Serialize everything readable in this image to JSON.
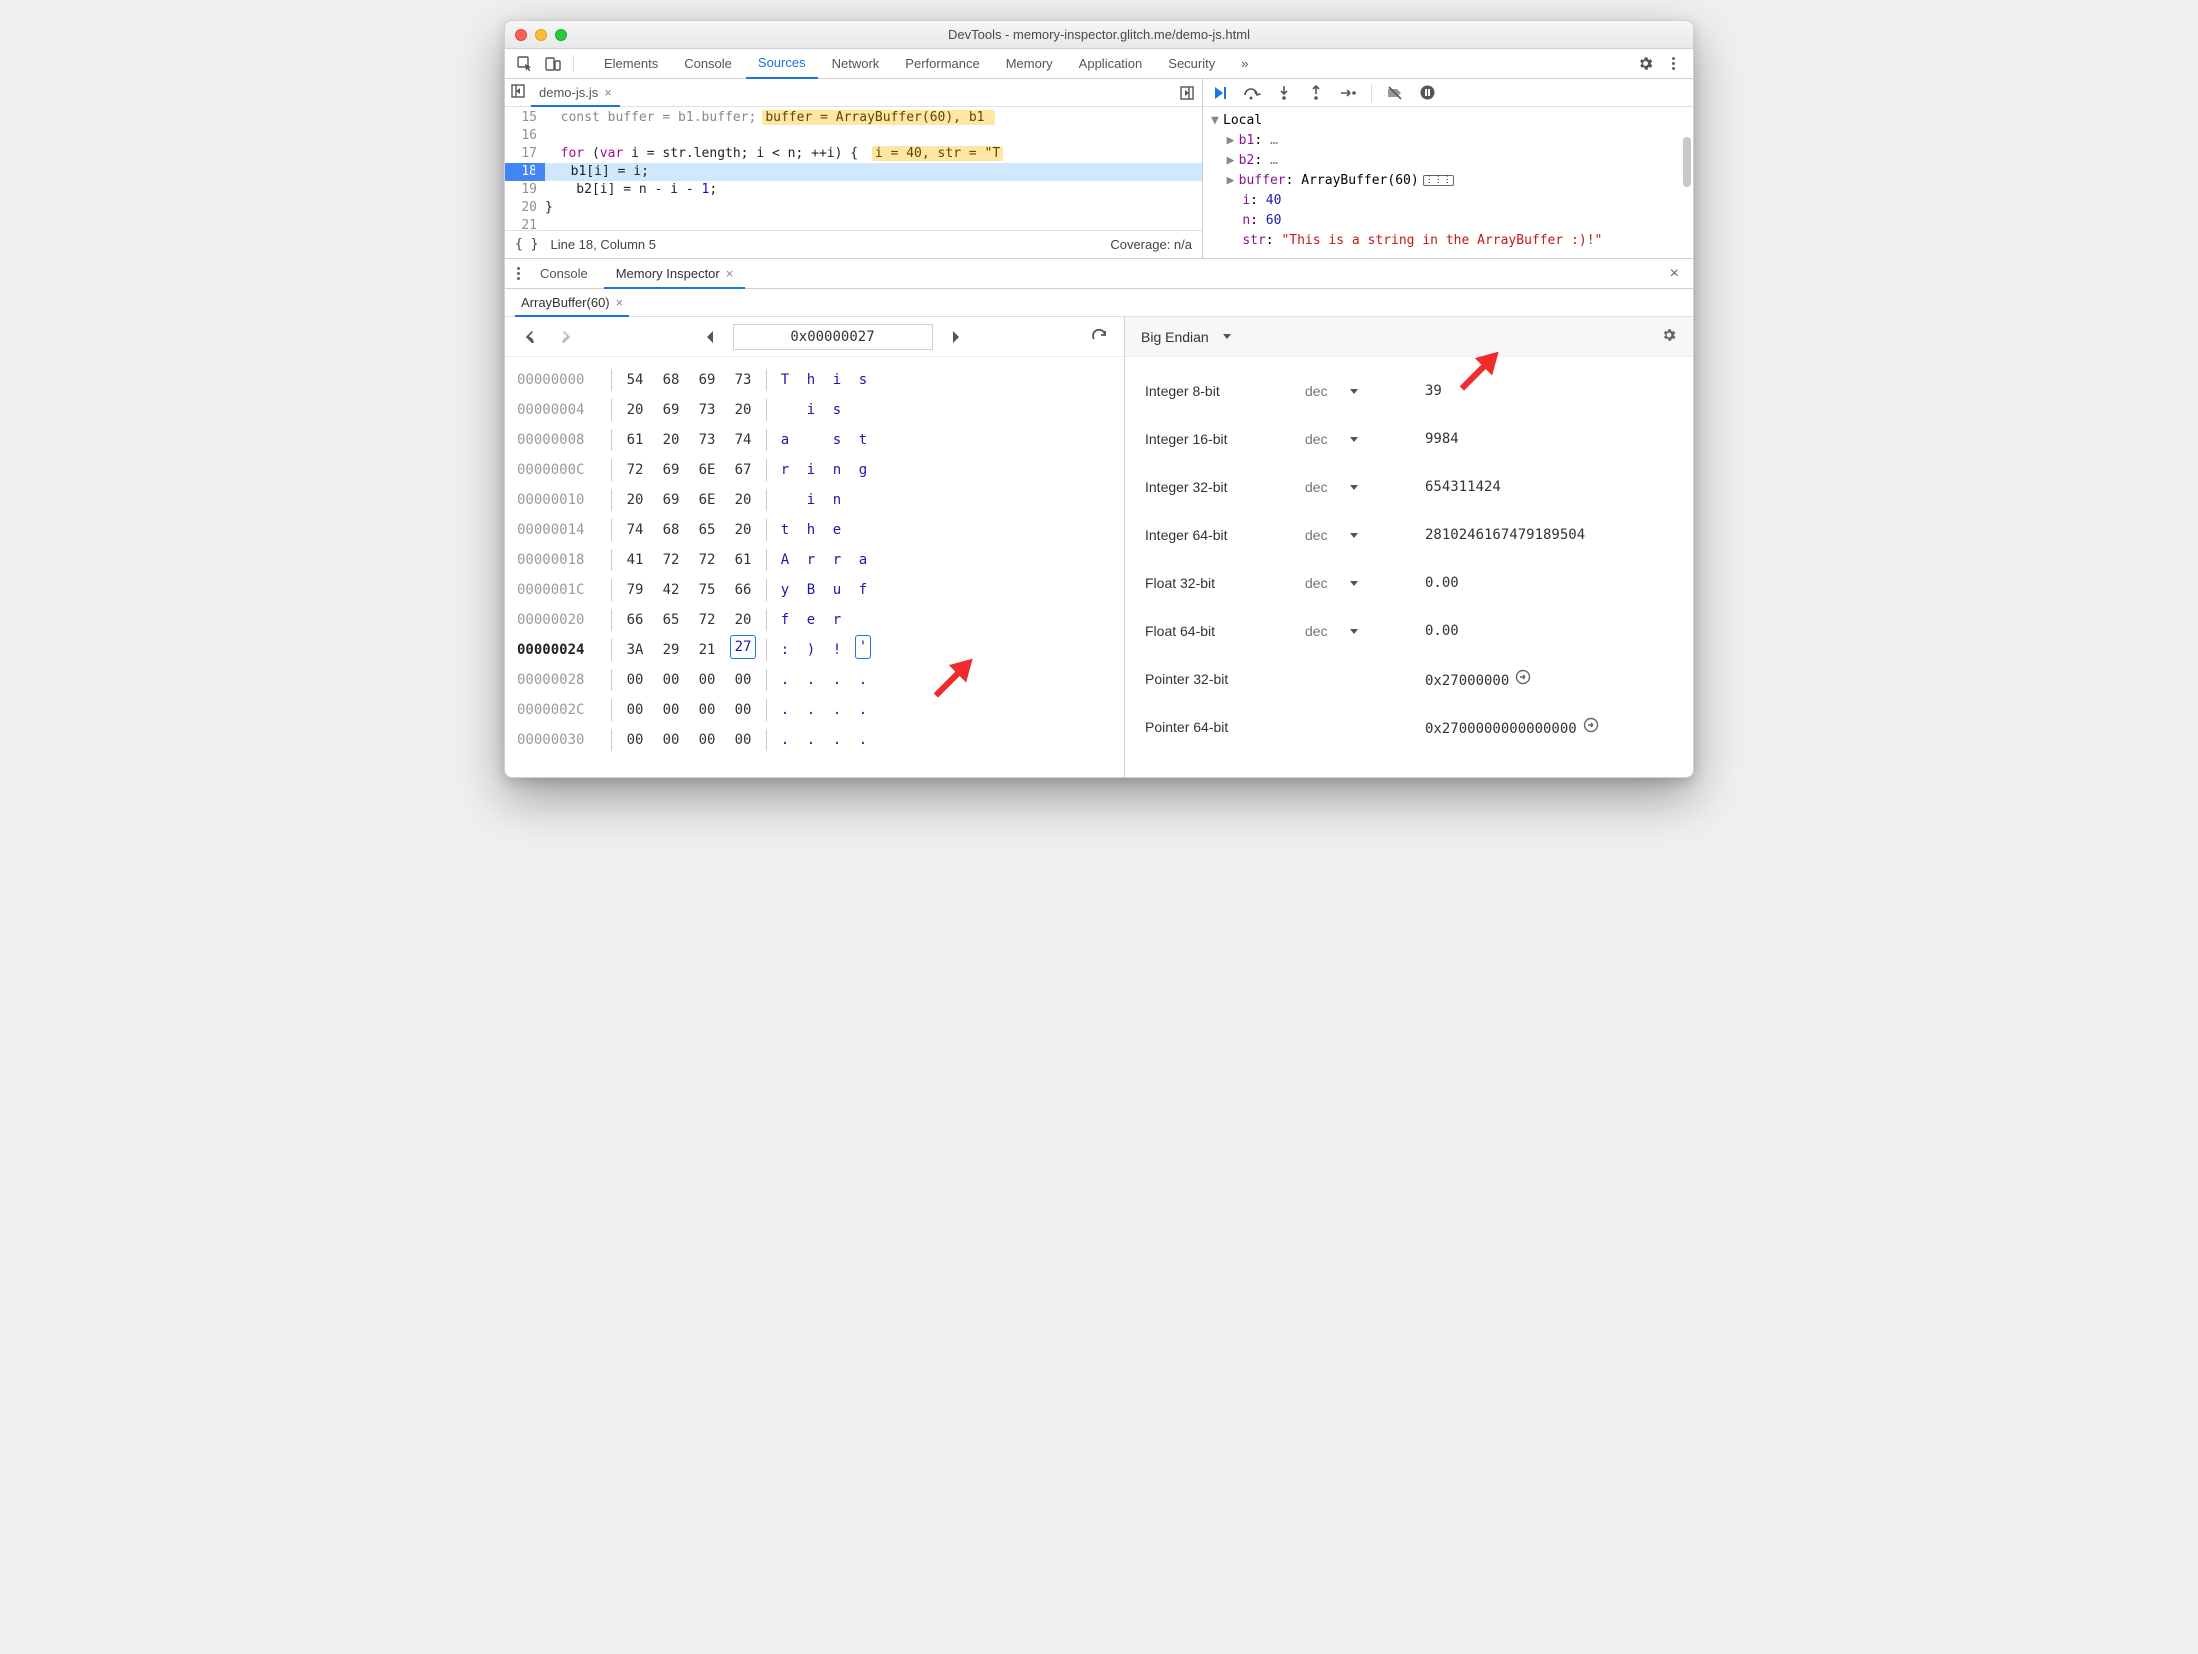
{
  "window": {
    "title": "DevTools - memory-inspector.glitch.me/demo-js.html"
  },
  "main_tabs": {
    "elements": "Elements",
    "console": "Console",
    "sources": "Sources",
    "network": "Network",
    "performance": "Performance",
    "memory": "Memory",
    "application": "Application",
    "security": "Security"
  },
  "source": {
    "file_tab": "demo-js.js",
    "lines": {
      "15": {
        "num": "15",
        "text": "const buffer = b1.buffer;",
        "inline": "buffer = ArrayBuffer(60), b1 "
      },
      "16": {
        "num": "16",
        "text": ""
      },
      "17": {
        "num": "17",
        "text": "for (var i = str.length; i < n; ++i) {",
        "inline": "i = 40, str = \"T"
      },
      "18": {
        "num": "18",
        "text": "  b1[i] = i;"
      },
      "19": {
        "num": "19",
        "text": "  b2[i] = n - i - 1;"
      },
      "20": {
        "num": "20",
        "text": "}"
      },
      "21": {
        "num": "21",
        "text": ""
      }
    },
    "status_line": "Line 18, Column 5",
    "status_coverage": "Coverage: n/a"
  },
  "scope": {
    "header": "Local",
    "b1": {
      "name": "b1",
      "val": "…"
    },
    "b2": {
      "name": "b2",
      "val": "…"
    },
    "buffer": {
      "name": "buffer",
      "val": "ArrayBuffer(60)"
    },
    "i": {
      "name": "i",
      "val": "40"
    },
    "n": {
      "name": "n",
      "val": "60"
    },
    "str": {
      "name": "str",
      "val": "\"This is a string in the ArrayBuffer :)!\""
    }
  },
  "drawer": {
    "console": "Console",
    "mem": "Memory Inspector"
  },
  "mi": {
    "tab": "ArrayBuffer(60)",
    "address": "0x00000027",
    "rows": [
      {
        "addr": "00000000",
        "b": [
          "54",
          "68",
          "69",
          "73"
        ],
        "a": [
          "T",
          "h",
          "i",
          "s"
        ]
      },
      {
        "addr": "00000004",
        "b": [
          "20",
          "69",
          "73",
          "20"
        ],
        "a": [
          "",
          "i",
          "s",
          ""
        ]
      },
      {
        "addr": "00000008",
        "b": [
          "61",
          "20",
          "73",
          "74"
        ],
        "a": [
          "a",
          "",
          "s",
          "t"
        ]
      },
      {
        "addr": "0000000C",
        "b": [
          "72",
          "69",
          "6E",
          "67"
        ],
        "a": [
          "r",
          "i",
          "n",
          "g"
        ]
      },
      {
        "addr": "00000010",
        "b": [
          "20",
          "69",
          "6E",
          "20"
        ],
        "a": [
          "",
          "i",
          "n",
          ""
        ]
      },
      {
        "addr": "00000014",
        "b": [
          "74",
          "68",
          "65",
          "20"
        ],
        "a": [
          "t",
          "h",
          "e",
          ""
        ]
      },
      {
        "addr": "00000018",
        "b": [
          "41",
          "72",
          "72",
          "61"
        ],
        "a": [
          "A",
          "r",
          "r",
          "a"
        ]
      },
      {
        "addr": "0000001C",
        "b": [
          "79",
          "42",
          "75",
          "66"
        ],
        "a": [
          "y",
          "B",
          "u",
          "f"
        ]
      },
      {
        "addr": "00000020",
        "b": [
          "66",
          "65",
          "72",
          "20"
        ],
        "a": [
          "f",
          "e",
          "r",
          ""
        ]
      },
      {
        "addr": "00000024",
        "b": [
          "3A",
          "29",
          "21",
          "27"
        ],
        "a": [
          ":",
          ")",
          "!",
          "'"
        ],
        "bold": true,
        "sel": 3
      },
      {
        "addr": "00000028",
        "b": [
          "00",
          "00",
          "00",
          "00"
        ],
        "a": [
          ".",
          ".",
          ".",
          "."
        ]
      },
      {
        "addr": "0000002C",
        "b": [
          "00",
          "00",
          "00",
          "00"
        ],
        "a": [
          ".",
          ".",
          ".",
          "."
        ]
      },
      {
        "addr": "00000030",
        "b": [
          "00",
          "00",
          "00",
          "00"
        ],
        "a": [
          ".",
          ".",
          ".",
          "."
        ]
      }
    ],
    "endian": "Big Endian",
    "values": [
      {
        "label": "Integer 8-bit",
        "fmt": "dec",
        "val": "39"
      },
      {
        "label": "Integer 16-bit",
        "fmt": "dec",
        "val": "9984"
      },
      {
        "label": "Integer 32-bit",
        "fmt": "dec",
        "val": "654311424"
      },
      {
        "label": "Integer 64-bit",
        "fmt": "dec",
        "val": "2810246167479189504"
      },
      {
        "label": "Float 32-bit",
        "fmt": "dec",
        "val": "0.00"
      },
      {
        "label": "Float 64-bit",
        "fmt": "dec",
        "val": "0.00"
      },
      {
        "label": "Pointer 32-bit",
        "fmt": "",
        "val": "0x27000000",
        "goto": true
      },
      {
        "label": "Pointer 64-bit",
        "fmt": "",
        "val": "0x2700000000000000",
        "goto": true
      }
    ]
  }
}
